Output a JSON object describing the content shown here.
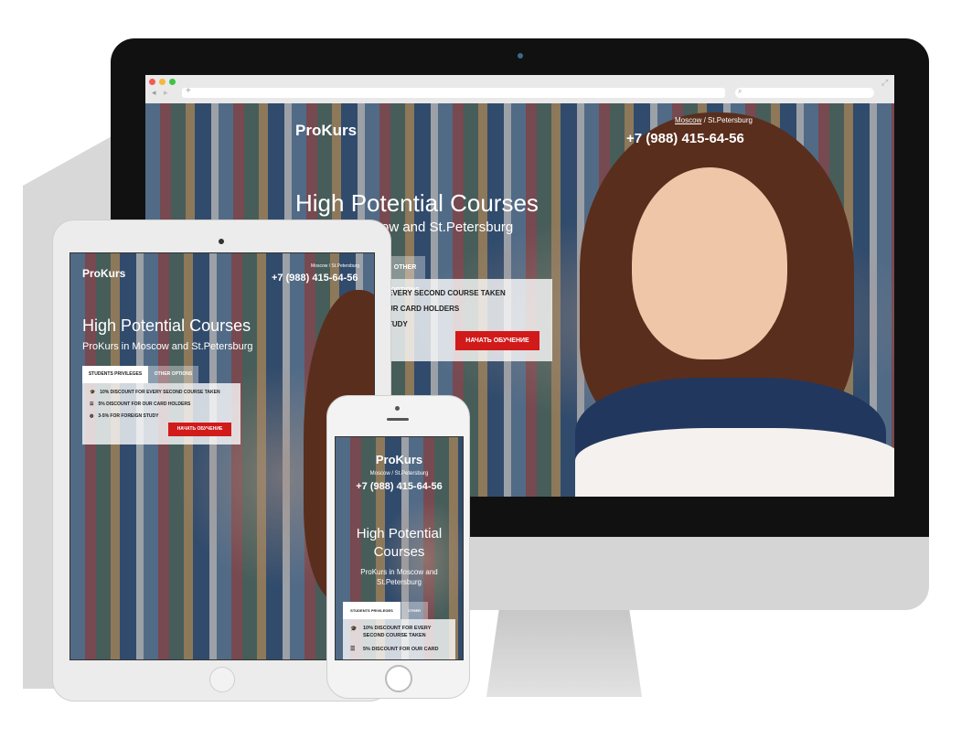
{
  "brand": "ProKurs",
  "cities": {
    "city1": "Moscow",
    "sep": " / ",
    "city2": "St.Petersburg",
    "full": "Moscow / St.Petersburg"
  },
  "phone": "+7 (988) 415-64-56",
  "hero": {
    "title": "High Potential Courses",
    "subtitle": "ProKurs in Moscow and St.Petersburg",
    "desktop_subtitle_visible": "ow and St.Petersburg",
    "mobile_title_line1": "High Potential",
    "mobile_title_line2": "Courses",
    "mobile_subtitle_line1": "ProKurs in Moscow and",
    "mobile_subtitle_line2": "St.Petersburg"
  },
  "tabs": {
    "privileges": "STUDENTS PRIVILEGES",
    "other": "OTHER OPTIONS",
    "other_short": "OTHER"
  },
  "perks": [
    {
      "icon": "graduation-cap-icon",
      "text": "10% DISCOUNT FOR EVERY SECOND COURSE TAKEN"
    },
    {
      "icon": "card-icon",
      "text": "5% DISCOUNT FOR OUR CARD HOLDERS"
    },
    {
      "icon": "globe-icon",
      "text": "3-5% FOR FOREIGN STUDY"
    }
  ],
  "desktop_perks_visible": [
    "EVERY SECOND COURSE TAKEN",
    "UR CARD HOLDERS",
    "TUDY"
  ],
  "mobile_perks": {
    "p1_line1": "10% DISCOUNT FOR EVERY",
    "p1_line2": "SECOND COURSE TAKEN",
    "p2": "5% DISCOUNT FOR OUR CARD"
  },
  "cta": "НАЧАТЬ ОБУЧЕНИЕ",
  "colors": {
    "accent": "#d11a1a",
    "text_light": "#ffffff"
  }
}
